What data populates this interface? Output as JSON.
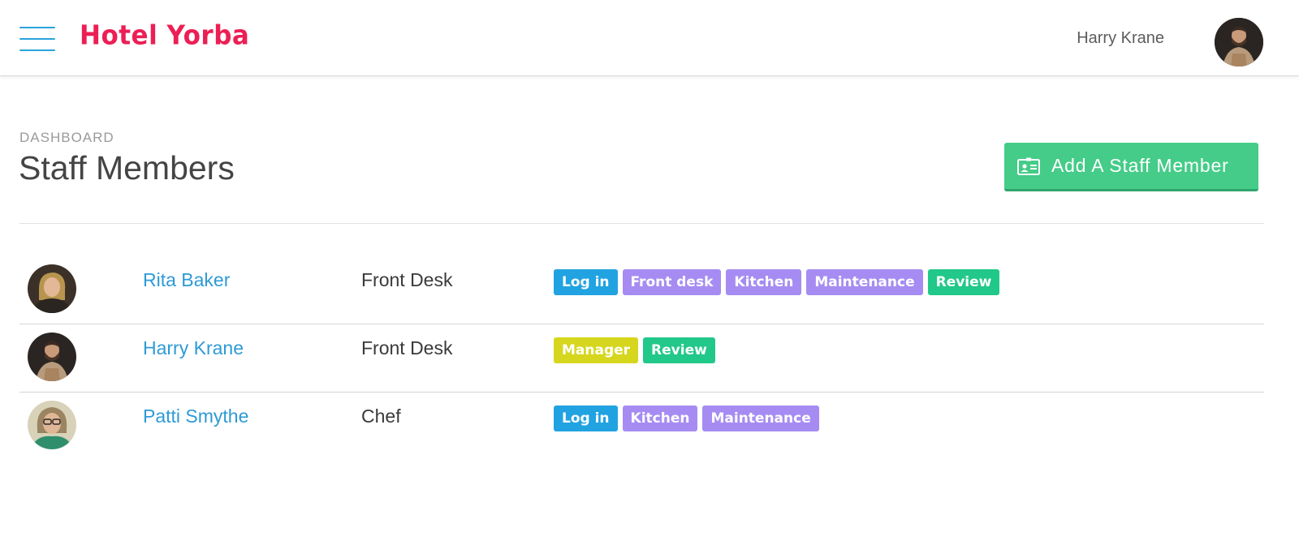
{
  "header": {
    "brand": "Hotel Yorba",
    "user_name": "Harry Krane"
  },
  "page": {
    "breadcrumb": "DASHBOARD",
    "title": "Staff Members",
    "add_button_label": "Add A Staff Member"
  },
  "colors": {
    "brand": "#ec1f55",
    "accent_blue": "#29a3dc",
    "add_button": "#44cc88",
    "tag_blue": "#21a3e1",
    "tag_purple": "#a68cf2",
    "tag_green": "#22c889",
    "tag_yellow": "#d6d61e"
  },
  "staff": [
    {
      "name": "Rita Baker",
      "department": "Front Desk",
      "tags": [
        {
          "label": "Log in",
          "color": "blue"
        },
        {
          "label": "Front desk",
          "color": "purple"
        },
        {
          "label": "Kitchen",
          "color": "purple"
        },
        {
          "label": "Maintenance",
          "color": "purple"
        },
        {
          "label": "Review",
          "color": "green"
        }
      ]
    },
    {
      "name": "Harry Krane",
      "department": "Front Desk",
      "tags": [
        {
          "label": "Manager",
          "color": "yellow"
        },
        {
          "label": "Review",
          "color": "green"
        }
      ]
    },
    {
      "name": "Patti Smythe",
      "department": "Chef",
      "tags": [
        {
          "label": "Log in",
          "color": "blue"
        },
        {
          "label": "Kitchen",
          "color": "purple"
        },
        {
          "label": "Maintenance",
          "color": "purple"
        }
      ]
    }
  ]
}
